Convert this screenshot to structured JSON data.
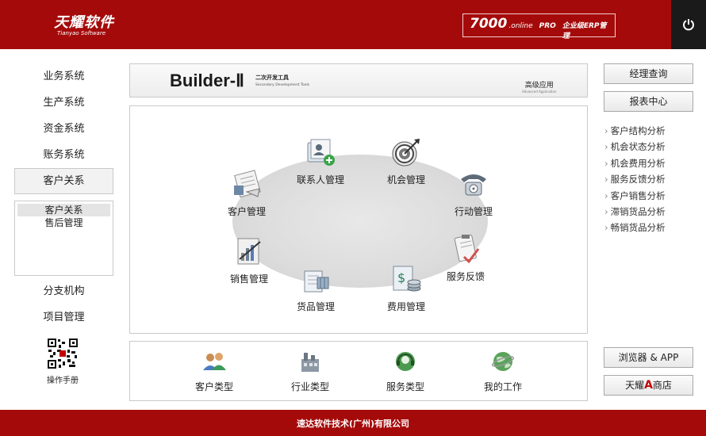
{
  "header": {
    "logo_cn": "天耀软件",
    "logo_en": "Tianyao Software",
    "badge_num": "7000",
    "badge_online": ".online",
    "badge_pro": "PRO",
    "badge_erp": "企业级ERP管理",
    "power_icon": "power-icon"
  },
  "left_nav": {
    "items": [
      "业务系统",
      "生产系统",
      "资金系统",
      "账务系统",
      "客户关系"
    ],
    "active": "客户关系",
    "sub_items": [
      "客户关系",
      "售后管理"
    ],
    "items_after": [
      "分支机构",
      "项目管理"
    ],
    "qr_label": "操作手册"
  },
  "banner": {
    "title": "Builder-Ⅱ",
    "sub_cn": "二次开发工具",
    "sub_en": "Secondary Development Tools",
    "adv_cn": "高级应用",
    "adv_en": "Advanced Application"
  },
  "modules": [
    {
      "label": "联系人管理",
      "icon": "contacts-folder-icon"
    },
    {
      "label": "机会管理",
      "icon": "target-icon"
    },
    {
      "label": "客户管理",
      "icon": "customer-card-icon"
    },
    {
      "label": "行动管理",
      "icon": "telephone-icon"
    },
    {
      "label": "销售管理",
      "icon": "sales-chart-icon"
    },
    {
      "label": "服务反馈",
      "icon": "clipboard-check-icon"
    },
    {
      "label": "货品管理",
      "icon": "goods-box-icon"
    },
    {
      "label": "费用管理",
      "icon": "cost-coins-icon"
    }
  ],
  "bottom_modules": [
    {
      "label": "客户类型",
      "icon": "users-icon"
    },
    {
      "label": "行业类型",
      "icon": "industry-icon"
    },
    {
      "label": "服务类型",
      "icon": "headset-icon"
    },
    {
      "label": "我的工作",
      "icon": "globe-icon"
    }
  ],
  "right": {
    "manager_query": "经理查询",
    "report_center": "报表中心",
    "reports": [
      "客户结构分析",
      "机会状态分析",
      "机会费用分析",
      "服务反馈分析",
      "客户销售分析",
      "滞销货品分析",
      "畅销货品分析"
    ],
    "browser_app": "浏览器 & APP",
    "shop_pre": "天耀",
    "shop_a": "A",
    "shop_post": "商店"
  },
  "footer": {
    "company": "速达软件技术(广州)有限公司"
  },
  "colors": {
    "brand_red": "#a50a0a",
    "power_bg": "#1a1a1a"
  }
}
